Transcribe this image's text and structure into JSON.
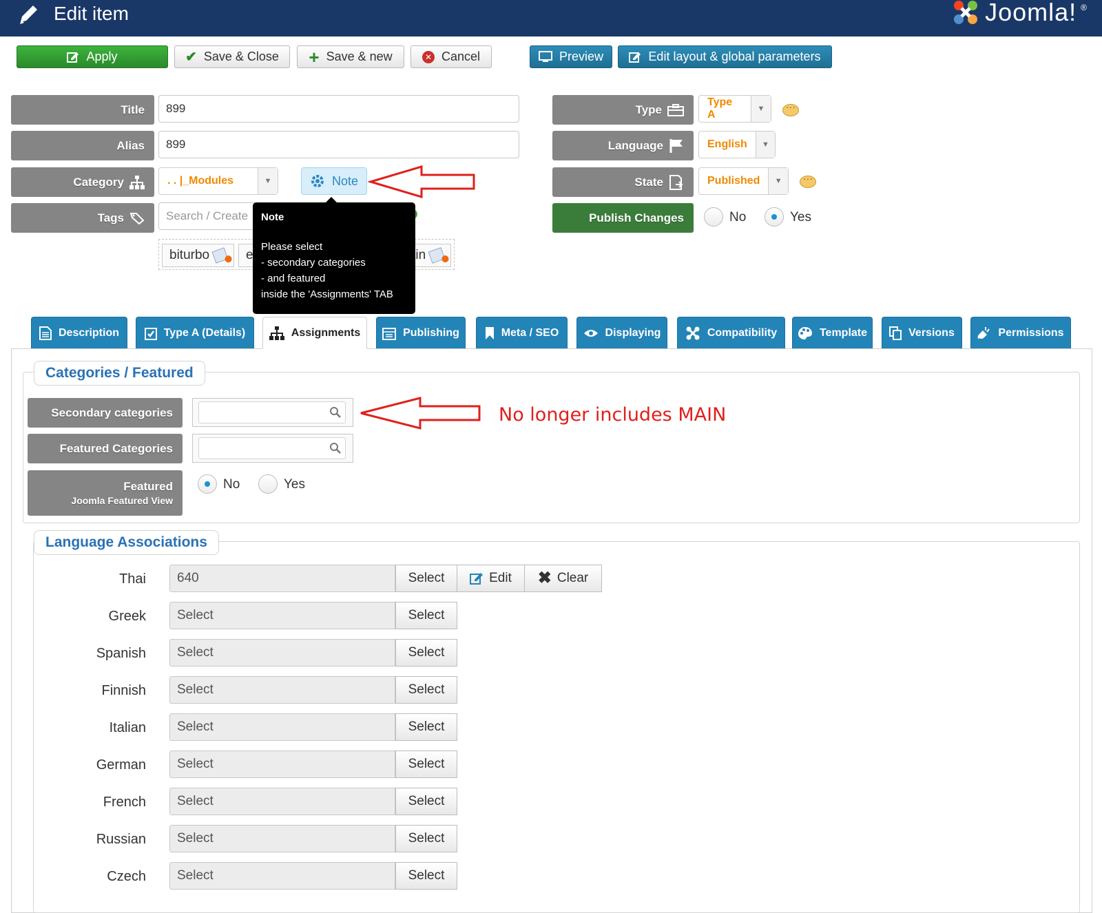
{
  "header": {
    "title": "Edit item",
    "logo_text": "Joomla!",
    "logo_reg": "®"
  },
  "toolbar": {
    "apply": "Apply",
    "save_close": "Save & Close",
    "save_new": "Save & new",
    "cancel": "Cancel",
    "preview": "Preview",
    "edit_layout": "Edit layout & global parameters"
  },
  "form": {
    "title_label": "Title",
    "title_value": "899",
    "alias_label": "Alias",
    "alias_value": "899",
    "category_label": "Category",
    "category_value": ". . |_Modules",
    "note_button": "Note",
    "tags_label": "Tags",
    "tags_placeholder": "Search / Create",
    "tags": [
      "biturbo",
      "e",
      "mountain"
    ],
    "type_label": "Type",
    "type_value": "Type A",
    "language_label": "Language",
    "language_value": "English",
    "state_label": "State",
    "state_value": "Published",
    "publish_changes_label": "Publish Changes",
    "publish_changes_no": "No",
    "publish_changes_yes": "Yes",
    "publish_changes_selected": "Yes"
  },
  "tooltip": {
    "title": "Note",
    "lines": [
      "Please select",
      "- secondary categories",
      "- and featured",
      "inside the 'Assignments' TAB"
    ]
  },
  "tabs": [
    {
      "label": "Description",
      "icon": "document-icon"
    },
    {
      "label": "Type A (Details)",
      "icon": "checklist-icon"
    },
    {
      "label": "Assignments",
      "icon": "sitemap-icon",
      "active": true
    },
    {
      "label": "Publishing",
      "icon": "calendar-icon"
    },
    {
      "label": "Meta / SEO",
      "icon": "bookmark-icon"
    },
    {
      "label": "Displaying",
      "icon": "eye-icon"
    },
    {
      "label": "Compatibility",
      "icon": "joomla-icon"
    },
    {
      "label": "Template",
      "icon": "palette-icon"
    },
    {
      "label": "Versions",
      "icon": "copy-icon"
    },
    {
      "label": "Permissions",
      "icon": "plug-icon"
    }
  ],
  "assignments": {
    "categories_legend": "Categories / Featured",
    "secondary_label": "Secondary categories",
    "featured_categories_label": "Featured Categories",
    "featured_label": "Featured",
    "featured_sublabel": "Joomla Featured View",
    "featured_no": "No",
    "featured_yes": "Yes",
    "featured_selected": "No",
    "annotation": "No longer includes MAIN"
  },
  "associations": {
    "legend": "Language Associations",
    "select_button": "Select",
    "edit_button": "Edit",
    "clear_button": "Clear",
    "rows": [
      {
        "lang": "Thai",
        "value": "640"
      },
      {
        "lang": "Greek",
        "value": "Select"
      },
      {
        "lang": "Spanish",
        "value": "Select"
      },
      {
        "lang": "Finnish",
        "value": "Select"
      },
      {
        "lang": "Italian",
        "value": "Select"
      },
      {
        "lang": "German",
        "value": "Select"
      },
      {
        "lang": "French",
        "value": "Select"
      },
      {
        "lang": "Russian",
        "value": "Select"
      },
      {
        "lang": "Czech",
        "value": "Select"
      }
    ]
  },
  "colors": {
    "header_bg": "#1a3867",
    "apply_green": "#2a8a2a",
    "tab_blue": "#2384b8",
    "annotation_red": "#e0201b",
    "dropdown_orange": "#f08a00"
  }
}
